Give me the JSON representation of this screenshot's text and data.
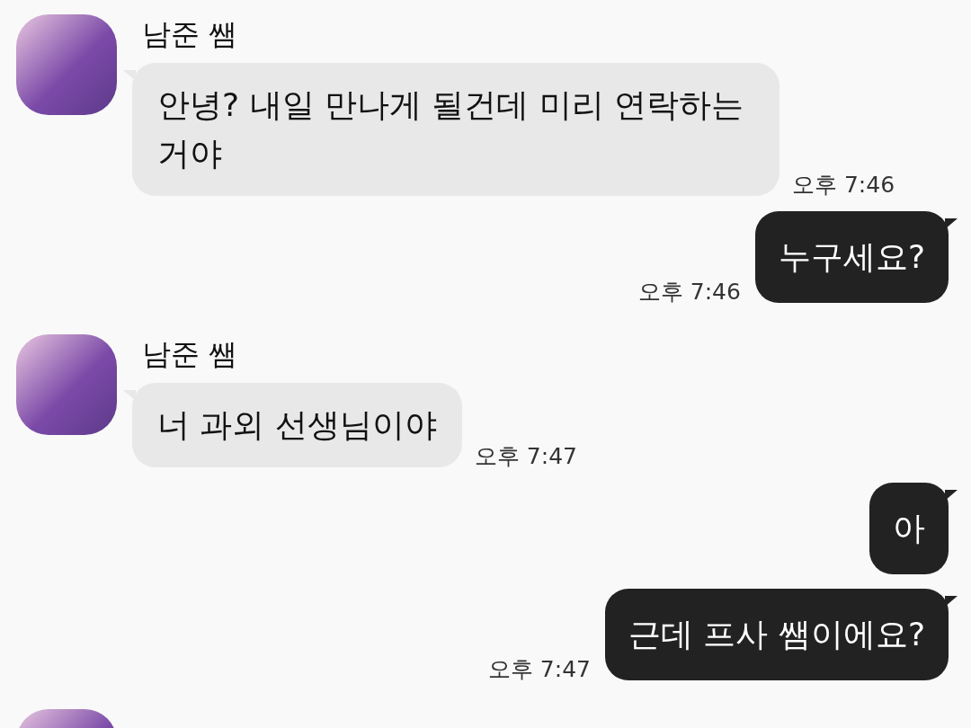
{
  "messages": [
    {
      "kind": "incoming",
      "name": "남준 쌤",
      "text": "안녕? 내일 만나게 될건데 미리 연락하는거야",
      "time": "오후 7:46"
    },
    {
      "kind": "outgoing",
      "text": "누구세요?",
      "time": "오후 7:46"
    },
    {
      "kind": "incoming",
      "name": "남준 쌤",
      "text": "너 과외 선생님이야",
      "time": "오후 7:47"
    },
    {
      "kind": "outgoing",
      "text": "아"
    },
    {
      "kind": "outgoing",
      "text": "근데 프사 쌤이에요?",
      "time": "오후 7:47"
    },
    {
      "kind": "avatar_only"
    }
  ]
}
